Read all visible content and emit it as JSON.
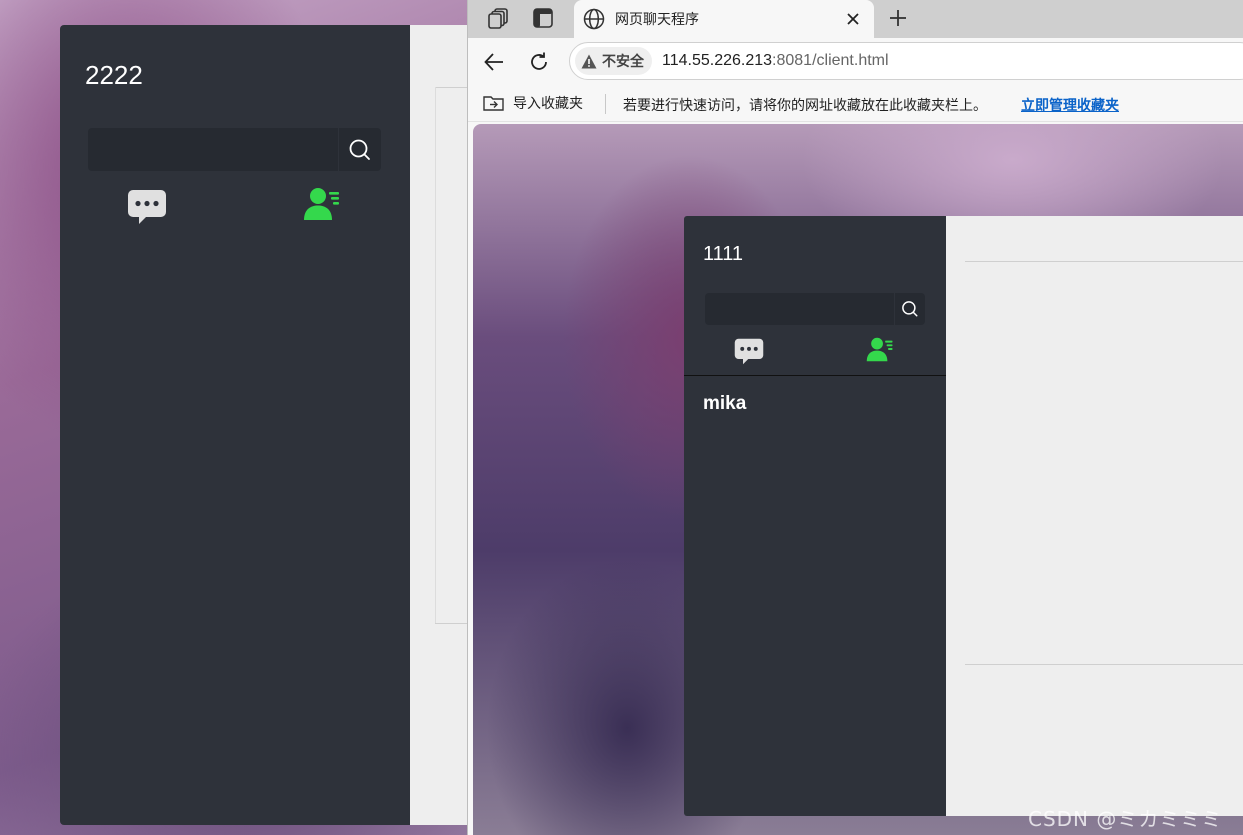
{
  "back_app": {
    "username": "2222",
    "search": {
      "value": "",
      "placeholder": ""
    },
    "tabs": [
      {
        "name": "chat",
        "icon": "chat-bubble-icon"
      },
      {
        "name": "contacts",
        "icon": "contacts-icon"
      }
    ]
  },
  "browser": {
    "tab": {
      "title": "网页聊天程序",
      "icon": "globe-icon"
    },
    "address": {
      "security_label": "不安全",
      "url_host": "114.55.226.213",
      "url_rest": ":8081/client.html"
    },
    "favorites_bar": {
      "import_label": "导入收藏夹",
      "hint": "若要进行快速访问，请将你的网址收藏放在此收藏夹栏上。",
      "manage_link": "立即管理收藏夹"
    }
  },
  "front_app": {
    "username": "1111",
    "search": {
      "value": "",
      "placeholder": ""
    },
    "tabs": [
      {
        "name": "chat",
        "icon": "chat-bubble-icon"
      },
      {
        "name": "contacts",
        "icon": "contacts-icon"
      }
    ],
    "contacts": [
      {
        "name": "mika"
      }
    ]
  },
  "watermark": "CSDN @ミカミミミ",
  "colors": {
    "panel": "#2e323a",
    "search_bg": "#262a31",
    "accent_green": "#34d84c",
    "main_bg": "#eeeeee",
    "link": "#0b63c9"
  }
}
